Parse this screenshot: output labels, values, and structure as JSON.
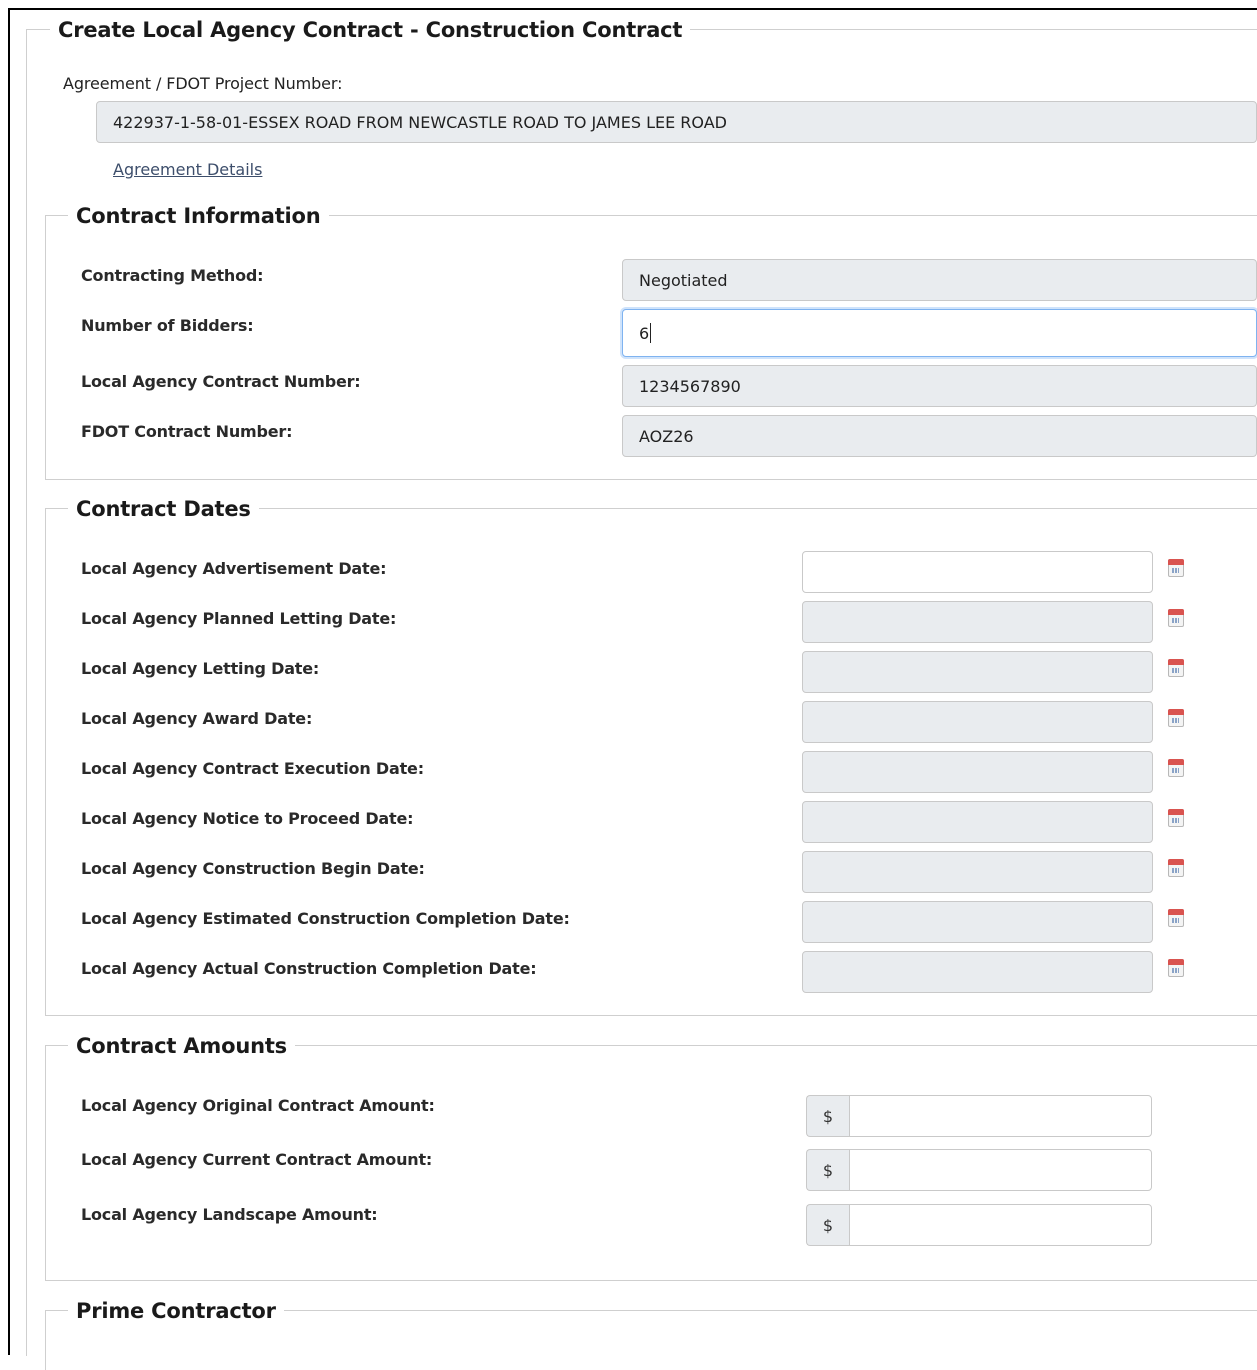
{
  "page": {
    "title": "Create Local Agency Contract - Construction Contract",
    "agreement_label": "Agreement / FDOT Project Number:",
    "agreement_value": "422937-1-58-01-ESSEX ROAD FROM NEWCASTLE ROAD TO JAMES LEE ROAD",
    "agreement_details_link": "Agreement Details"
  },
  "contract_info": {
    "legend": "Contract Information",
    "contracting_method_label": "Contracting Method:",
    "contracting_method_value": "Negotiated",
    "bidders_label": "Number of Bidders:",
    "bidders_value": "6",
    "la_contract_number_label": "Local Agency Contract Number:",
    "la_contract_number_value": "1234567890",
    "fdot_contract_number_label": "FDOT Contract Number:",
    "fdot_contract_number_value": "AOZ26"
  },
  "contract_dates": {
    "legend": "Contract Dates",
    "items": [
      {
        "label": "Local Agency Advertisement Date:",
        "value": "",
        "editable": true
      },
      {
        "label": "Local Agency Planned Letting Date:",
        "value": "",
        "editable": false
      },
      {
        "label": "Local Agency Letting Date:",
        "value": "",
        "editable": false
      },
      {
        "label": "Local Agency Award Date:",
        "value": "",
        "editable": false
      },
      {
        "label": "Local Agency Contract Execution Date:",
        "value": "",
        "editable": false
      },
      {
        "label": "Local Agency Notice to Proceed Date:",
        "value": "",
        "editable": false
      },
      {
        "label": "Local Agency Construction Begin Date:",
        "value": "",
        "editable": false
      },
      {
        "label": "Local Agency Estimated Construction Completion Date:",
        "value": "",
        "editable": false
      },
      {
        "label": "Local Agency Actual Construction Completion Date:",
        "value": "",
        "editable": false
      }
    ],
    "icon": "calendar-icon"
  },
  "contract_amounts": {
    "legend": "Contract Amounts",
    "currency_symbol": "$",
    "items": [
      {
        "label": "Local Agency Original Contract Amount:",
        "value": ""
      },
      {
        "label": "Local Agency Current Contract Amount:",
        "value": ""
      },
      {
        "label": "Local Agency Landscape Amount:",
        "value": ""
      }
    ]
  },
  "prime_contractor": {
    "legend": "Prime Contractor"
  }
}
